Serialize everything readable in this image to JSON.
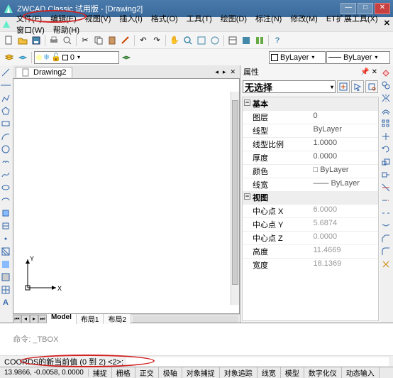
{
  "title": "ZWCAD Classic 试用版 - [Drawing2]",
  "menus": [
    "文件(F)",
    "编辑(E)",
    "视图(V)",
    "插入(I)",
    "格式(O)",
    "工具(T)",
    "绘图(D)",
    "标注(N)",
    "修改(M)",
    "ET扩展工具(X)",
    "窗口(W)",
    "帮助(H)"
  ],
  "doc_name": "Drawing2",
  "layer_combo": "0",
  "color_combo": "ByLayer",
  "ltype_combo": "ByLayer",
  "model_tabs": [
    "Model",
    "布局1",
    "布局2"
  ],
  "prop": {
    "title": "属性",
    "selection": "无选择",
    "cat_basic": "基本",
    "rows_basic": [
      {
        "k": "图层",
        "v": "0"
      },
      {
        "k": "线型",
        "v": "ByLayer"
      },
      {
        "k": "线型比例",
        "v": "1.0000"
      },
      {
        "k": "厚度",
        "v": "0.0000"
      },
      {
        "k": "颜色",
        "v": "□ ByLayer"
      },
      {
        "k": "线宽",
        "v": "—— ByLayer"
      }
    ],
    "cat_view": "视图",
    "rows_view": [
      {
        "k": "中心点 X",
        "v": "6.0000",
        "ro": true
      },
      {
        "k": "中心点 Y",
        "v": "5.6874",
        "ro": true
      },
      {
        "k": "中心点 Z",
        "v": "0.0000",
        "ro": true
      },
      {
        "k": "高度",
        "v": "11.4669",
        "ro": true
      },
      {
        "k": "宽度",
        "v": "18.1369",
        "ro": true
      }
    ]
  },
  "cmd": {
    "prefix": "命令:",
    "text": "COORDS",
    "prompt": "COORDS的新当前值 (0 到 2) <2>:"
  },
  "status": {
    "coords": "13.9866, -0.0058, 0.0000",
    "modes": [
      "捕捉",
      "栅格",
      "正交",
      "极轴",
      "对象捕捉",
      "对象追踪",
      "线宽",
      "模型",
      "数字化仪",
      "动态输入"
    ]
  }
}
